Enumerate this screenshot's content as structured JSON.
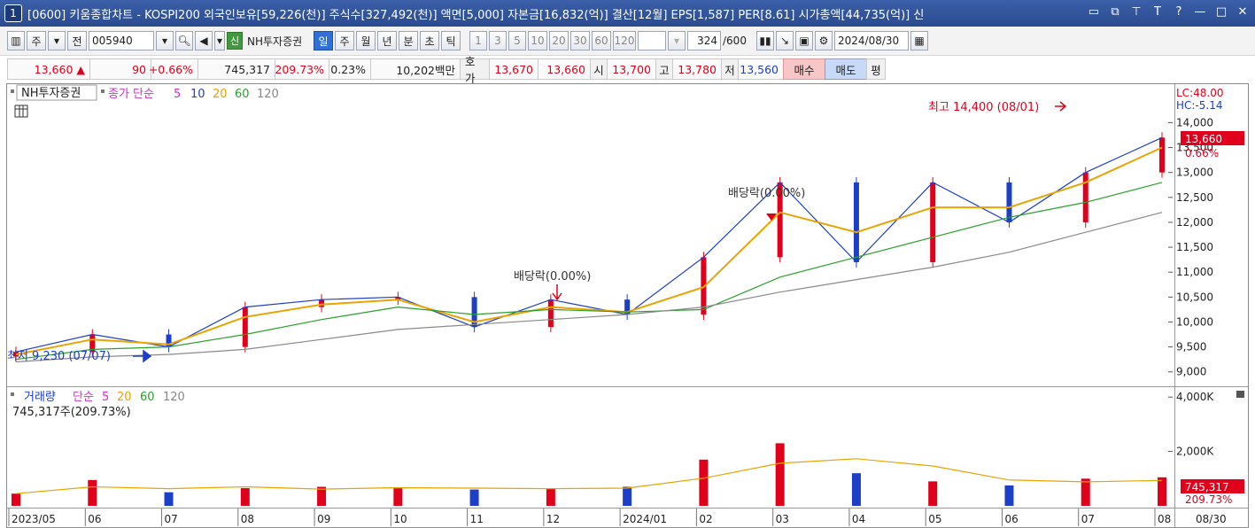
{
  "window": {
    "number": "1",
    "title": "[0600] 키움종합차트 - KOSPI200 외국인보유[59,226(천)] 주식수[327,492(천)] 액면[5,000] 자본금[16,832(억)] 결산[12월] EPS[1,587] PER[8.61] 시가총액[44,735(억)] 신"
  },
  "toolbar": {
    "period_mode": "주",
    "prev_label": "전",
    "stock_code": "005940",
    "broker_badge": "신",
    "broker_name": "NH투자증권",
    "periods": [
      "일",
      "주",
      "월",
      "년",
      "분",
      "초",
      "틱"
    ],
    "active_period": "일",
    "intervals": [
      "1",
      "3",
      "5",
      "10",
      "20",
      "30",
      "60",
      "120"
    ],
    "count_current": "324",
    "count_max": "/600",
    "date": "2024/08/30"
  },
  "quote": {
    "price": "13,660",
    "change": "90",
    "change_pct": "+0.66%",
    "volume": "745,317",
    "volume_ratio": "209.73%",
    "turnover": "0.23%",
    "amount": "10,202백만",
    "ask_label": "호가",
    "ask": "13,670",
    "bid": "13,660",
    "open_label": "시",
    "open": "13,700",
    "high_label": "고",
    "high": "13,780",
    "low_label": "저",
    "low": "13,560",
    "buy_label": "매수",
    "sell_label": "매도",
    "avg_label": "평"
  },
  "price_panel": {
    "stock_name": "NH투자증권",
    "legend_prefix": "종가 단순",
    "ma_periods": [
      "5",
      "10",
      "20",
      "60",
      "120"
    ],
    "lc": "LC:48.00",
    "hc": "HC:-5.14",
    "current_price_tag": "13,660",
    "current_pct_tag": "0.66%",
    "high_annotation": "최고 14,400 (08/01)",
    "low_annotation": "최저 9,230 (07/07)",
    "dividend_annotation_1": "배당락(0.00%)",
    "dividend_annotation_2": "배당락(0.00%)"
  },
  "volume_panel": {
    "title": "거래량",
    "legend_prefix": "단순",
    "ma_periods": [
      "5",
      "20",
      "60",
      "120"
    ],
    "current_label": "745,317주(209.73%)",
    "current_tag": "745,317",
    "current_pct_tag": "209.73%"
  },
  "x_axis": {
    "labels": [
      "2023/05",
      "06",
      "07",
      "08",
      "09",
      "10",
      "11",
      "12",
      "2024/01",
      "02",
      "03",
      "04",
      "05",
      "06",
      "07",
      "08"
    ],
    "end_label": "08/30"
  },
  "colors": {
    "up": "#e0001b",
    "down": "#1d3fc7",
    "ma5": "#d42fc7",
    "ma10": "#1d3fc7",
    "ma20": "#e8a400",
    "ma60": "#2aa02a",
    "ma120": "#8a8a8a"
  },
  "chart_data": [
    {
      "type": "line",
      "title": "",
      "ylabel": "",
      "ylim": [
        8800,
        14700
      ],
      "y_ticks": [
        9000,
        9500,
        10000,
        10500,
        11000,
        11500,
        12000,
        12500,
        13000,
        13500,
        14000
      ],
      "x": [
        "2023/05",
        "06",
        "07",
        "08",
        "09",
        "10",
        "11",
        "12",
        "2024/01",
        "02",
        "03",
        "04",
        "05",
        "06",
        "07",
        "08"
      ],
      "series": [
        {
          "name": "종가",
          "values": [
            9400,
            9750,
            9500,
            10300,
            10450,
            10500,
            9900,
            10450,
            10150,
            11300,
            12800,
            11200,
            12800,
            12000,
            13000,
            13700
          ]
        },
        {
          "name": "20",
          "values": [
            9350,
            9650,
            9550,
            10100,
            10350,
            10450,
            10000,
            10300,
            10200,
            10700,
            12200,
            11800,
            12300,
            12300,
            12800,
            13500
          ]
        },
        {
          "name": "60",
          "values": [
            9250,
            9450,
            9500,
            9750,
            10050,
            10300,
            10150,
            10250,
            10200,
            10250,
            10900,
            11300,
            11700,
            12100,
            12400,
            12800
          ]
        },
        {
          "name": "120",
          "values": [
            9200,
            9300,
            9350,
            9450,
            9650,
            9850,
            9950,
            10050,
            10150,
            10300,
            10600,
            10850,
            11100,
            11400,
            11800,
            12200
          ]
        }
      ],
      "annotations": [
        {
          "text": "최고 14,400 (08/01)",
          "x": "08",
          "y": 14400
        },
        {
          "text": "최저 9,230 (07/07)",
          "x": "07",
          "y": 9230
        },
        {
          "text": "배당락(0.00%)",
          "x": "12",
          "y": 10550
        },
        {
          "text": "배당락(0.00%)",
          "x": "03",
          "y": 12700
        }
      ]
    },
    {
      "type": "bar",
      "title": "",
      "ylabel": "",
      "ylim": [
        0,
        4300000
      ],
      "y_ticks": [
        2000000,
        4000000
      ],
      "x": [
        "2023/05",
        "06",
        "07",
        "08",
        "09",
        "10",
        "11",
        "12",
        "2024/01",
        "02",
        "03",
        "04",
        "05",
        "06",
        "07",
        "08"
      ],
      "series": [
        {
          "name": "거래량",
          "values": [
            450000,
            950000,
            500000,
            650000,
            700000,
            650000,
            600000,
            650000,
            700000,
            1700000,
            2300000,
            1200000,
            900000,
            750000,
            1000000,
            1050000
          ]
        }
      ]
    }
  ]
}
